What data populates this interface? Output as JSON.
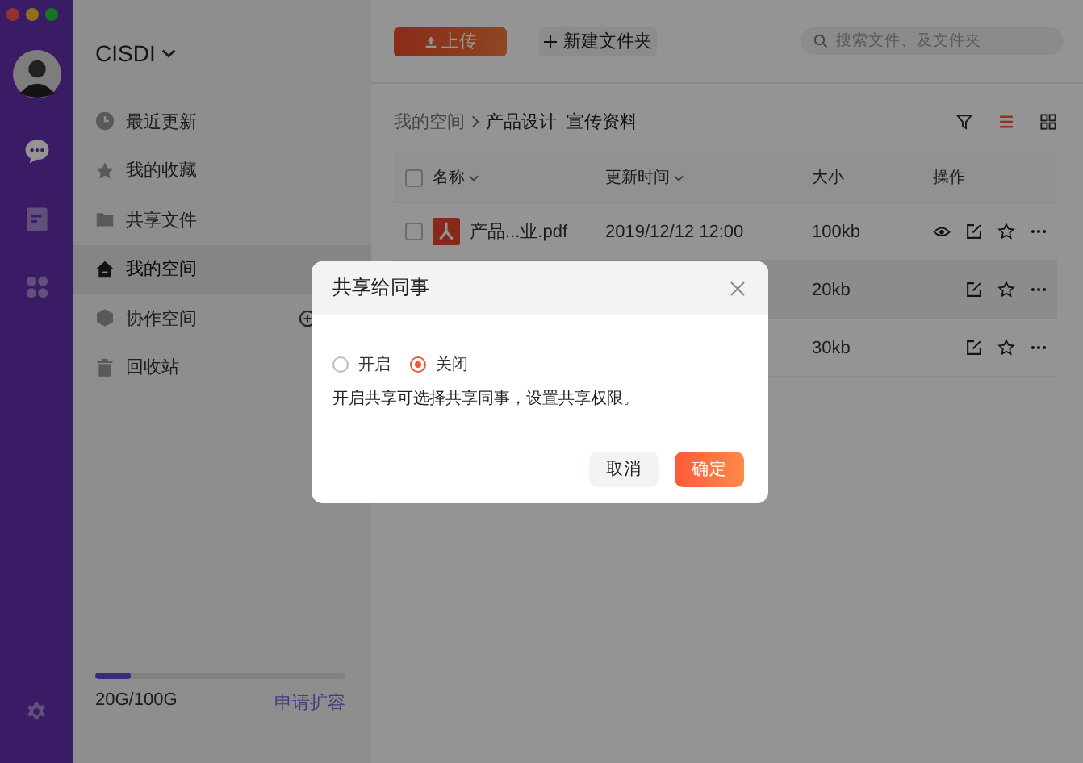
{
  "workspace": {
    "name": "CISDI"
  },
  "nav": [
    {
      "label": "最近更新",
      "selected": false
    },
    {
      "label": "我的收藏",
      "selected": false
    },
    {
      "label": "共享文件",
      "selected": false
    },
    {
      "label": "我的空间",
      "selected": true
    },
    {
      "label": "协作空间",
      "selected": false
    },
    {
      "label": "回收站",
      "selected": false
    }
  ],
  "storage": {
    "level": 0.14,
    "usage": "20G/100G",
    "link": "申请扩容"
  },
  "toolbar": {
    "upload": "上传",
    "new_folder": "新建文件夹",
    "search": {
      "placeholder": "搜索文件、及文件夹"
    }
  },
  "breadcrumb": {
    "root": "我的空间",
    "path": "产品设计  宣传资料"
  },
  "views": [
    {
      "selected": false
    },
    {
      "selected": true
    },
    {
      "selected": false
    }
  ],
  "table": {
    "all_checked": false,
    "columns": [
      {
        "label": "名称",
        "sortable": true
      },
      {
        "label": "更新时间",
        "sortable": true
      },
      {
        "label": "大小",
        "sortable": false
      },
      {
        "label": "操作",
        "sortable": false
      }
    ],
    "rows": [
      {
        "name": "产品...业.pdf",
        "updated": "2019/12/12 12:00",
        "size": "100kb",
        "checked": false,
        "preview": true,
        "hovered": false
      },
      {
        "size": "20kb",
        "preview": false,
        "hovered": true
      },
      {
        "size": "30kb",
        "preview": false,
        "hovered": false
      }
    ]
  },
  "dialog": {
    "title": "共享给同事",
    "options": [
      {
        "label": "开启",
        "selected": false
      },
      {
        "label": "关闭",
        "selected": true
      }
    ],
    "description": "开启共享可选择共享同事，设置共享权限。",
    "buttons": [
      {
        "label": "取消",
        "kind": "secondary"
      },
      {
        "label": "确定",
        "kind": "primary"
      }
    ]
  }
}
